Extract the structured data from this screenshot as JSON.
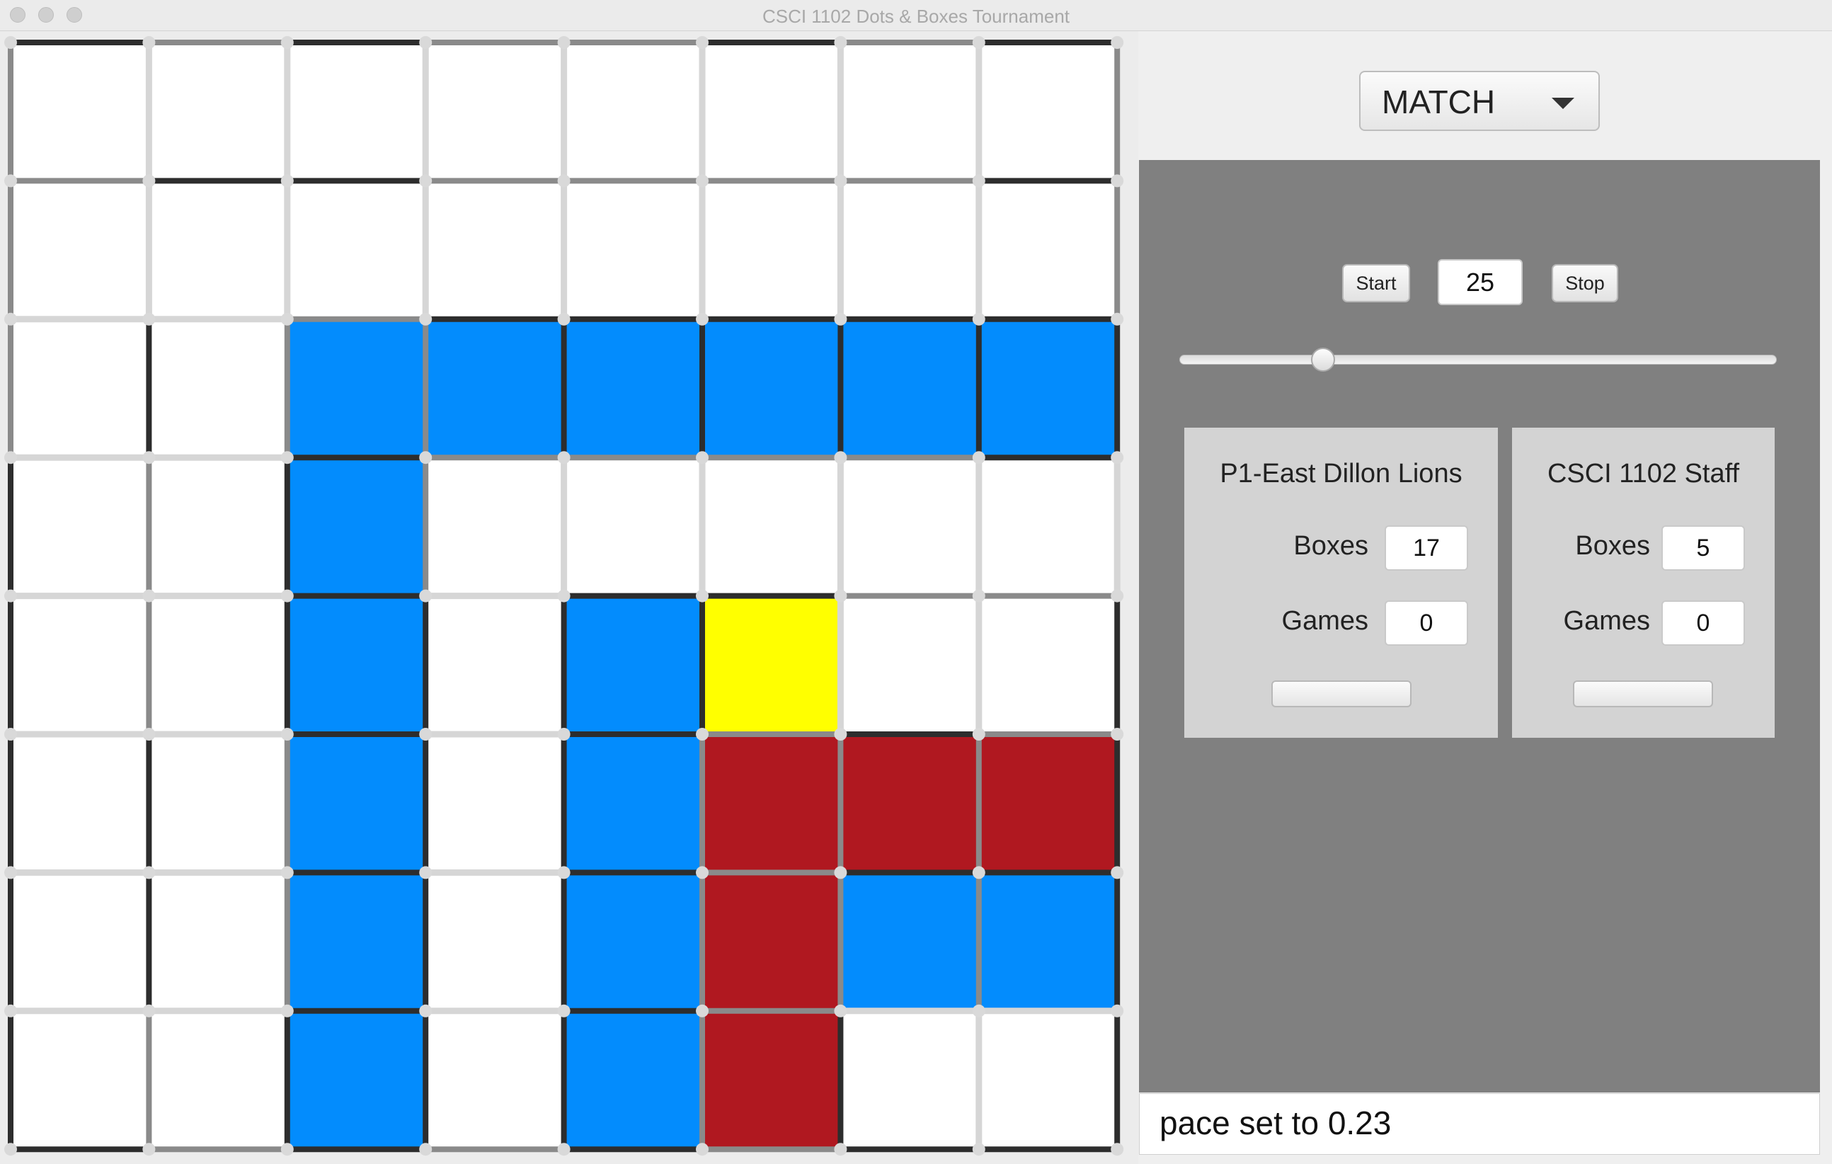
{
  "window": {
    "title": "CSCI 1102 Dots & Boxes Tournament"
  },
  "mode_selector": {
    "value": "MATCH"
  },
  "controls": {
    "start_label": "Start",
    "stop_label": "Stop",
    "pace_value": "25",
    "slider_value": 0.23
  },
  "players": [
    {
      "name": "P1-East Dillon Lions",
      "boxes_label": "Boxes",
      "boxes": "17",
      "games_label": "Games",
      "games": "0"
    },
    {
      "name": "CSCI 1102 Staff",
      "boxes_label": "Boxes",
      "boxes": "5",
      "games_label": "Games",
      "games": "0"
    }
  ],
  "status": {
    "message": "pace set to 0.23"
  },
  "colors": {
    "blue": "#038cfd",
    "red": "#b01820",
    "yellow": "#ffff00",
    "empty": "#ffffff",
    "line_drawn": "#2d2d2d",
    "line_alt": "#8a8a8a",
    "line_empty": "#d6d6d6"
  },
  "board": {
    "rows": 8,
    "cols": 8,
    "boxes": [
      "WWWWWWWW",
      "WWWWWWWW",
      "WWBBBBBB",
      "WWBWWWWW",
      "WWBWBYWW",
      "WWBWBRRR",
      "WWBWBRBB",
      "WWBWBRWW"
    ],
    "h_lines": [
      "DMDMMDMD",
      "MDDMMMMD",
      "LLMDDDDD",
      "LLDMMMMD",
      "LLDLDDMM",
      "LLDLDMDM",
      "LLDLDMDD",
      "LLDLDMLL",
      "DMDMDMDD"
    ],
    "v_lines": [
      "MLLLLLLLM",
      "MLLLLLLLM",
      "MDMMDDDDD",
      "DMDMLLLLL",
      "DMDDDDLLD",
      "DDMDDMMMD",
      "DDMDDMMMD",
      "DMDDDMDLD"
    ]
  }
}
